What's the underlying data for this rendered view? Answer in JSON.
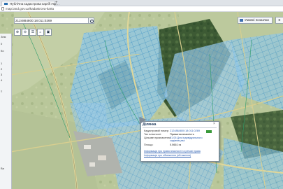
{
  "browser": {
    "tab_title": "Публічна кадастрова карта Укр…",
    "tab_close": "×",
    "new_tab": "+",
    "url": "map.land.gov.ua/kadastrova-karta"
  },
  "map": {
    "search_value": "2124884800:18:011:0269",
    "legend_button": "Умовні позначки",
    "corner_button": "≡",
    "toolbar": [
      "⊕",
      "⊖",
      "☰",
      "⌂",
      "▣"
    ]
  },
  "left_panel": {
    "items": [
      "Зем",
      "0",
      "Ко",
      "1",
      "2",
      "3",
      "4",
      "≡",
      "Ва"
    ]
  },
  "popup": {
    "title": "Ділянка",
    "close": "×",
    "rows": [
      {
        "label": "Кадастровий номер:",
        "value": "2124884800:18:011:0269"
      },
      {
        "label": "Тип власності:",
        "value": "Приватна власність"
      },
      {
        "label": "Цільове призначення:",
        "value": "01.05 Для індивідуального садівництва"
      },
      {
        "label": "Площа:",
        "value": "0.0661 га"
      }
    ],
    "links": [
      "Інформація про право власності та речові права",
      "Інформація про обмеження (обтяження)"
    ]
  },
  "colors": {
    "parcel_fill": "#8fc6e8",
    "parcel_stroke": "#1e7fbf",
    "road": "#e0d79a",
    "accent": "#3a9a3a"
  }
}
